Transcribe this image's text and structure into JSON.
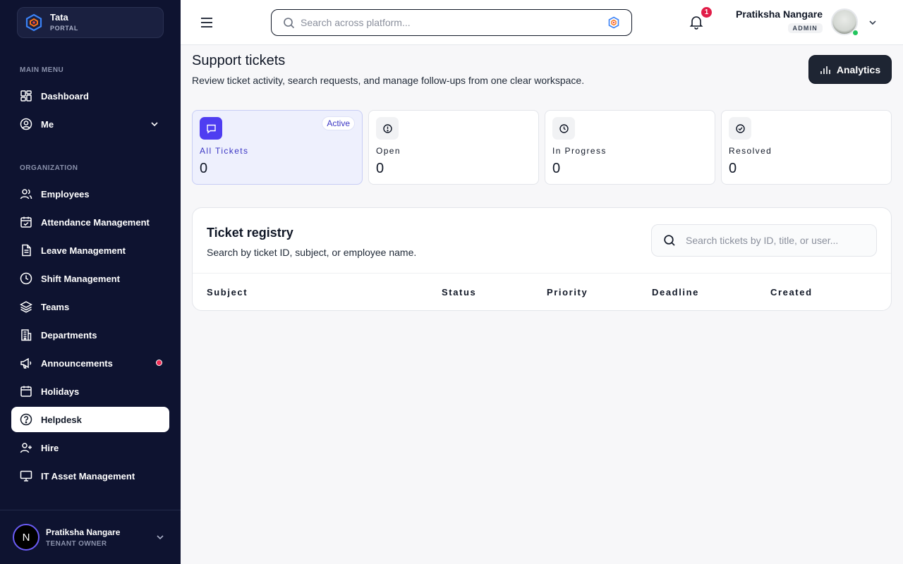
{
  "brand": {
    "name": "Tata",
    "sub": "PORTAL"
  },
  "sidebar": {
    "main_menu_label": "MAIN MENU",
    "org_label": "ORGANIZATION",
    "main_items": [
      {
        "label": "Dashboard",
        "icon": "dashboard-icon"
      },
      {
        "label": "Me",
        "icon": "user-circle-icon"
      }
    ],
    "org_items": [
      {
        "label": "Employees",
        "icon": "users-icon"
      },
      {
        "label": "Attendance Management",
        "icon": "calendar-check-icon"
      },
      {
        "label": "Leave Management",
        "icon": "document-icon"
      },
      {
        "label": "Shift Management",
        "icon": "clock-icon"
      },
      {
        "label": "Teams",
        "icon": "layers-icon"
      },
      {
        "label": "Departments",
        "icon": "building-icon"
      },
      {
        "label": "Announcements",
        "icon": "megaphone-icon"
      },
      {
        "label": "Holidays",
        "icon": "calendar-icon"
      },
      {
        "label": "Helpdesk",
        "icon": "help-circle-icon"
      },
      {
        "label": "Hire",
        "icon": "user-plus-icon"
      },
      {
        "label": "IT Asset Management",
        "icon": "monitor-icon"
      }
    ],
    "active_item": "Helpdesk"
  },
  "footer_user": {
    "initial": "N",
    "name": "Pratiksha Nangare",
    "role": "TENANT OWNER"
  },
  "topbar": {
    "search_placeholder": "Search across platform...",
    "notification_count": "1",
    "user_name": "Pratiksha Nangare",
    "user_role": "ADMIN"
  },
  "page": {
    "title": "Support tickets",
    "subtitle": "Review ticket activity, search requests, and manage follow-ups from one clear workspace.",
    "analytics_label": "Analytics"
  },
  "stats": [
    {
      "label": "All Tickets",
      "value": "0",
      "badge": "Active",
      "icon": "chat-icon"
    },
    {
      "label": "Open",
      "value": "0",
      "icon": "alert-circle-icon"
    },
    {
      "label": "In Progress",
      "value": "0",
      "icon": "clock-icon"
    },
    {
      "label": "Resolved",
      "value": "0",
      "icon": "check-circle-icon"
    }
  ],
  "registry": {
    "title": "Ticket registry",
    "subtitle": "Search by ticket ID, subject, or employee name.",
    "search_placeholder": "Search tickets by ID, title, or user...",
    "columns": [
      "Subject",
      "Status",
      "Priority",
      "Deadline",
      "Created"
    ]
  },
  "colors": {
    "sidebar_bg": "#0e1330",
    "accent": "#4f3df1",
    "badge_red": "#e11d48",
    "online": "#22c55e"
  }
}
